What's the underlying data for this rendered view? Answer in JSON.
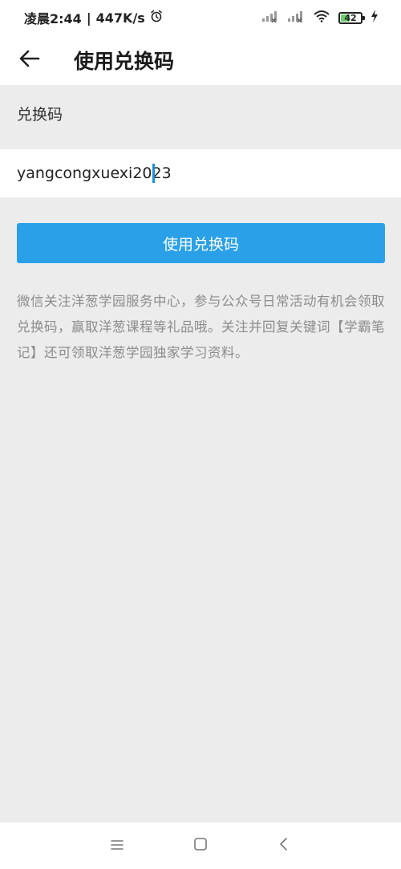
{
  "status_bar": {
    "time": "凌晨2:44",
    "speed": "447K/s",
    "battery": "42"
  },
  "header": {
    "title": "使用兑换码"
  },
  "form": {
    "label": "兑换码",
    "code_value": "yangcongxuexi2023",
    "submit_label": "使用兑换码"
  },
  "description": "微信关注洋葱学园服务中心，参与公众号日常活动有机会领取兑换码，赢取洋葱课程等礼品哦。关注并回复关键词【学霸笔记】还可领取洋葱学园独家学习资料。",
  "colors": {
    "accent": "#2aa0e8",
    "background": "#ececec",
    "caret": "#1a8ee0",
    "battery": "#6cd06a"
  },
  "icons": {
    "back": "arrow-left-icon",
    "alarm": "alarm-clock-icon",
    "signal": "signal-icon",
    "wifi": "wifi-icon",
    "charging": "charging-bolt-icon",
    "nav_menu": "menu-icon",
    "nav_home": "home-square-icon",
    "nav_back": "chevron-left-icon"
  }
}
